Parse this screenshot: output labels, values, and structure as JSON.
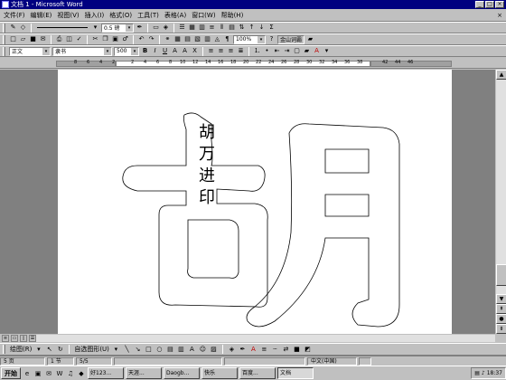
{
  "window": {
    "title": "文档 1 - Microsoft Word"
  },
  "menu": {
    "items": [
      "文件(F)",
      "编辑(E)",
      "视图(V)",
      "插入(I)",
      "格式(O)",
      "工具(T)",
      "表格(A)",
      "窗口(W)",
      "帮助(H)"
    ]
  },
  "toolbar1": {
    "line_width": "0.5 磅"
  },
  "toolbar2": {
    "zoom": "100%",
    "font_box": "金山词霸"
  },
  "toolbar3": {
    "style": "正文",
    "font": "隶书",
    "size": "500"
  },
  "ruler": {
    "ticks": [
      "8",
      "6",
      "4",
      "2",
      "2",
      "4",
      "6",
      "8",
      "10",
      "12",
      "14",
      "16",
      "18",
      "20",
      "22",
      "24",
      "26",
      "28",
      "30",
      "32",
      "34",
      "36",
      "38",
      "42",
      "44",
      "46"
    ]
  },
  "document": {
    "big_char": "胡",
    "vertical_text": [
      "胡",
      "万",
      "进",
      "印"
    ]
  },
  "drawing_toolbar": {
    "draw": "绘图(R)",
    "autoshapes": "自选图形(U)"
  },
  "status": {
    "page": "5 页",
    "section": "1 节",
    "page_of": "5/5",
    "lang": "中文(中国)"
  },
  "taskbar": {
    "start": "开始",
    "tasks": [
      "好123...",
      "天涯...",
      "Daogb...",
      "快乐",
      "百度...",
      "文档"
    ],
    "time": "18:37"
  }
}
